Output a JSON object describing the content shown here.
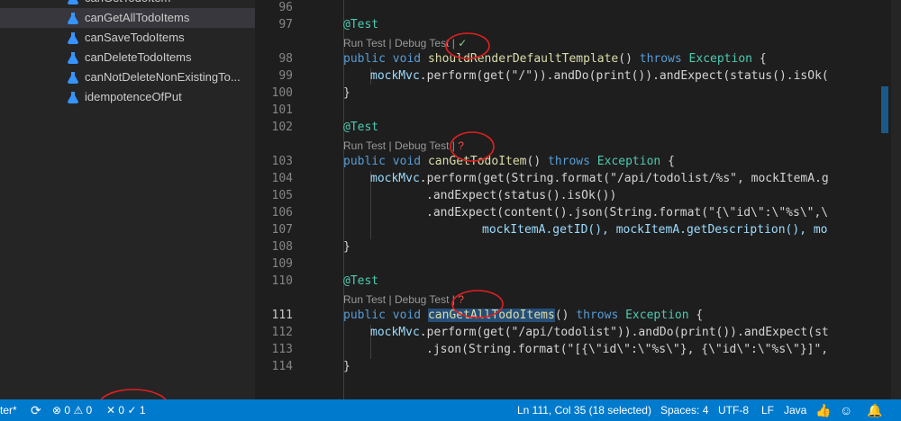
{
  "sidebar": {
    "items": [
      {
        "label": "canGetTodoItem"
      },
      {
        "label": "canGetAllTodoItems"
      },
      {
        "label": "canSaveTodoItems"
      },
      {
        "label": "canDeleteTodoItems"
      },
      {
        "label": "canNotDeleteNonExistingTo..."
      },
      {
        "label": "idempotenceOfPut"
      }
    ]
  },
  "editor": {
    "line_numbers": [
      "96",
      "97",
      "98",
      "99",
      "100",
      "101",
      "102",
      "103",
      "104",
      "105",
      "106",
      "107",
      "108",
      "109",
      "110",
      "111",
      "112",
      "113",
      "114"
    ],
    "active_line": "111",
    "codelens": {
      "run_label": "Run Test",
      "separator": " | ",
      "debug_label": "Debug Test",
      "pipe": " |",
      "pass_glyph": "✓",
      "unknown_glyph": "?"
    },
    "code": {
      "annotation": "@Test",
      "public": "public",
      "void": "void",
      "throws": "throws",
      "exception": "Exception",
      "brace_open": " {",
      "m1_name": "shouldRenderDefaultTemplate",
      "m2_name": "canGetTodoItem",
      "m3_name": "canGetAllTodoItems",
      "parens": "()",
      "close_brace": "}",
      "l98_body_a": "mockMvc",
      "l98_body_b": ".perform(get(\"/\")).andDo(print()).andExpect(status().isOk(",
      "l104_a": "mockMvc",
      "l104_b": ".perform(get(String.format(\"/api/todolist/%s\", mockItemA.g",
      "l105": ".andExpect(status().isOk())",
      "l106": ".andExpect(content().json(String.format(\"{\\\"id\\\":\\\"%s\\\",\\",
      "l107": "mockItemA.getID(), mockItemA.getDescription(), mo",
      "l112_a": "mockMvc",
      "l112_b": ".perform(get(\"/api/todolist\")).andDo(print()).andExpect(st",
      "l113": ".json(String.format(\"[{\\\"id\\\":\\\"%s\\\"}, {\\\"id\\\":\\\"%s\\\"}]\","
    }
  },
  "statusbar": {
    "left_text": "ter*",
    "sync_glyph": "⟳",
    "errors": "0",
    "warnings": "0",
    "test_failed": "0",
    "test_passed": "1",
    "position": "Ln 111, Col 35 (18 selected)",
    "spaces": "Spaces: 4",
    "encoding": "UTF-8",
    "eol": "LF",
    "language": "Java",
    "colors": {
      "bar": "#007acc"
    }
  }
}
